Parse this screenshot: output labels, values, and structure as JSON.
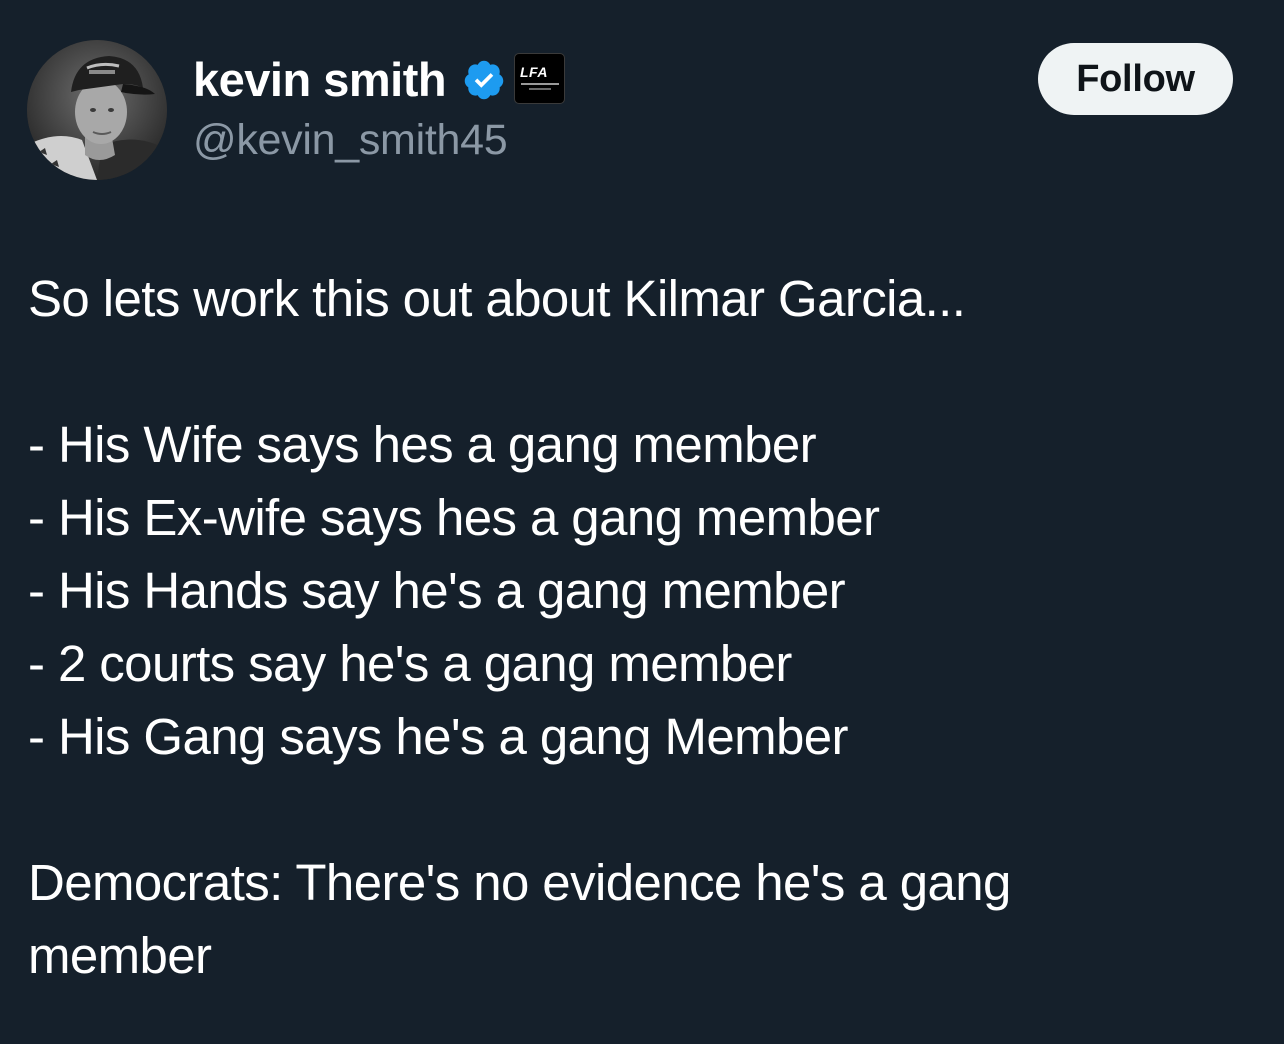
{
  "author": {
    "display_name": "kevin smith",
    "handle": "@kevin_smith45",
    "verified_icon": "verified-check-icon",
    "affiliate_badge": {
      "label": "LFA",
      "icon": "lfa-affiliate-logo"
    },
    "avatar_icon": "profile-photo"
  },
  "follow_button": {
    "label": "Follow"
  },
  "tweet": {
    "intro": "So lets work this out about Kilmar Garcia...",
    "list": [
      "- His Wife says hes a gang member",
      "- His Ex-wife says hes a gang member",
      "- His Hands say he's a gang member",
      "- 2 courts say he's a gang member",
      "- His Gang says he's a gang Member"
    ],
    "conclusion_line1": "Democrats: There's no evidence he's a gang",
    "conclusion_line2": "member"
  },
  "colors": {
    "background": "#15202b",
    "text": "#ffffff",
    "secondary_text": "#8b98a5",
    "verified": "#1d9bf0",
    "button_bg": "#eff3f4",
    "button_text": "#0f1419"
  }
}
